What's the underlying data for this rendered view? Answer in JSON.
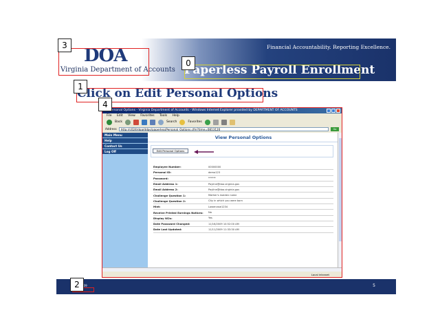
{
  "header": {
    "logo_mark": "DOA",
    "logo_sub": "Virginia Department of Accounts",
    "tagline": "Financial Accountability. Reporting Excellence.",
    "title": "Paperless Payroll Enrollment"
  },
  "step_title": "Click on Edit Personal Options",
  "browser": {
    "window_title": "Personal Options - Virginia Department of Accounts - Windows Internet Explorer provided by DEPARTMENT OF ACCOUNTS",
    "menu": [
      "File",
      "Edit",
      "View",
      "Favorites",
      "Tools",
      "Help"
    ],
    "toolbar": {
      "back": "Back",
      "search": "Search",
      "favorites": "Favorites"
    },
    "address_label": "Address",
    "address_value": "http://c024/doa/ddps/paperlessPersonal_Options.cfm?time=0813120",
    "go_label": "Go",
    "status_right": "Local intranet"
  },
  "sidebar": {
    "items": [
      {
        "label": "Main Menu"
      },
      {
        "label": "Help"
      },
      {
        "label": "Contact Us"
      },
      {
        "label": "Log Off"
      }
    ]
  },
  "page": {
    "title": "View Personal Options",
    "edit_button": "Edit Personal Options"
  },
  "info_rows": [
    {
      "label": "Employee Number:",
      "value": "00000000"
    },
    {
      "label": "Personal ID:",
      "value": "demo123"
    },
    {
      "label": "Password:",
      "value": "******"
    },
    {
      "label": "Email Address 1:",
      "value": "Payline@doa.virginia.gov"
    },
    {
      "label": "Email Address 2:",
      "value": "Payline@doa.virginia.gov"
    },
    {
      "label": "Challenge Question 1:",
      "value": "Mother's maiden name"
    },
    {
      "label": "Challenge Question 2:",
      "value": "City in which you were born"
    },
    {
      "label": "Hint:",
      "value": "Lowercase1234"
    },
    {
      "label": "Receive Printed Earnings Notices:",
      "value": "No"
    },
    {
      "label": "Display W2s:",
      "value": "Yes"
    },
    {
      "label": "Date Password Changed:",
      "value": "11/16/2009 10:52:00 AM"
    },
    {
      "label": "Date Last Updated:",
      "value": "11/11/2009 11:33:30 AM"
    }
  ],
  "footer": {
    "date": "12/2009",
    "page_number": "5"
  },
  "annotations": [
    {
      "label": "0"
    },
    {
      "label": "1"
    },
    {
      "label": "2"
    },
    {
      "label": "3"
    },
    {
      "label": "4"
    }
  ],
  "colors": {
    "navy": "#1a326a",
    "sidebar_blue": "#9ec9ee",
    "nav_item": "#1f4b86",
    "title_blue": "#2a5a9a",
    "annotation_red": "#e02020",
    "annotation_yellow": "#d6d236"
  }
}
